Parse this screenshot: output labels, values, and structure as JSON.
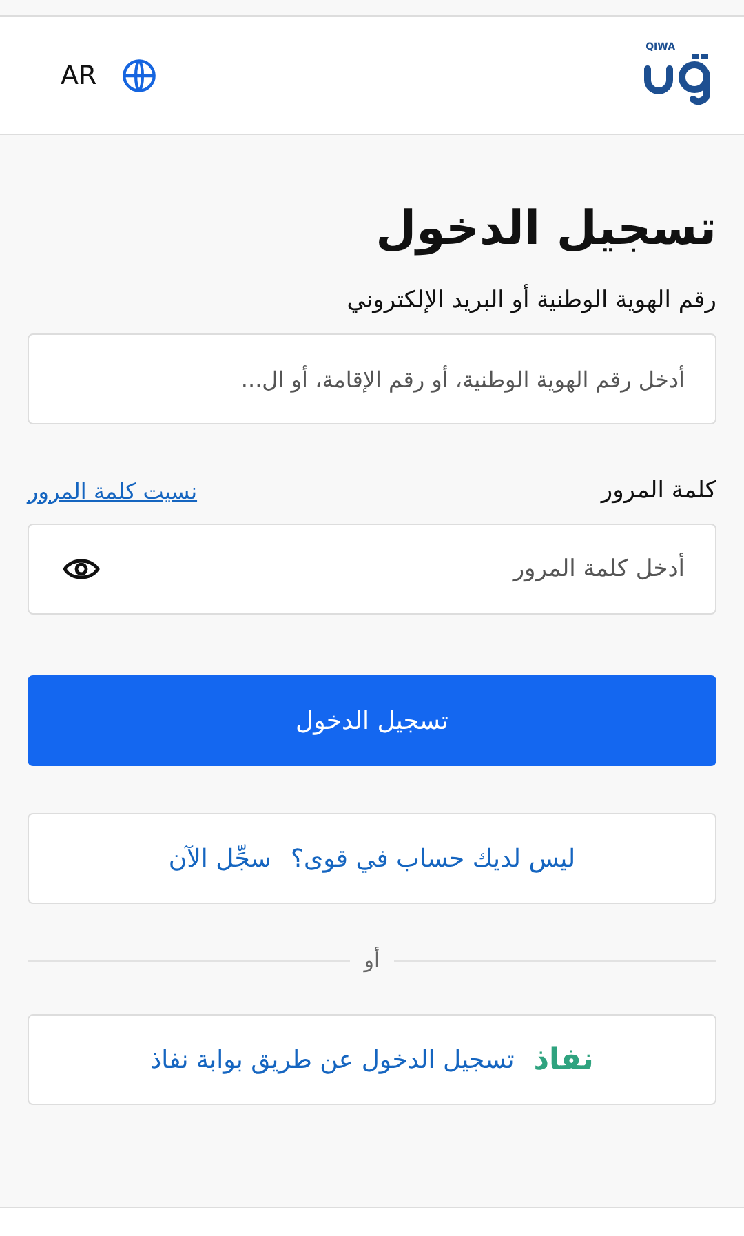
{
  "header": {
    "logo_text": "QIWA",
    "language": "AR"
  },
  "title": "تسجيل الدخول",
  "id_field": {
    "label": "رقم الهوية الوطنية أو البريد الإلكتروني",
    "placeholder": "أدخل رقم الهوية الوطنية، أو رقم الإقامة، أو ال..."
  },
  "password_field": {
    "label": "كلمة المرور",
    "forgot_link": "نسيت كلمة المرور",
    "placeholder": "أدخل كلمة المرور"
  },
  "login_button": "تسجيل الدخول",
  "register": {
    "question": "ليس لديك حساب في قوى؟",
    "link": "سجِّل الآن"
  },
  "divider_text": "أو",
  "nafath": {
    "logo_text": "نفاذ",
    "label": "تسجيل الدخول عن طريق بوابة نفاذ"
  }
}
